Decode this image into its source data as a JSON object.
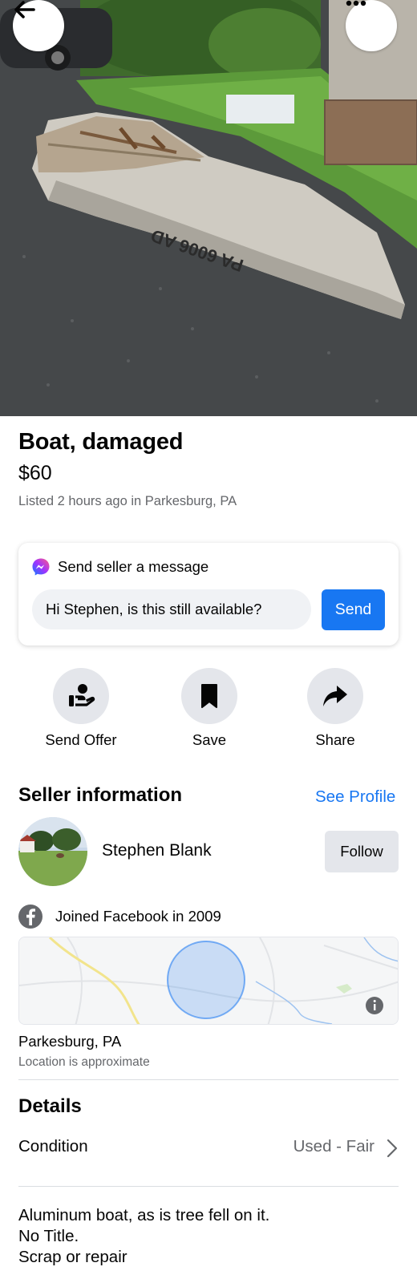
{
  "header": {
    "back_icon": "arrow-left-icon",
    "more_icon": "more-horizontal-icon",
    "photo_plate_text": "PA 6006 AD"
  },
  "listing": {
    "title": "Boat, damaged",
    "price": "$60",
    "listed": "Listed 2 hours ago in Parkesburg, PA"
  },
  "message": {
    "icon": "messenger-icon",
    "heading": "Send seller a message",
    "input_value": "Hi Stephen, is this still available?",
    "send_label": "Send"
  },
  "actions": [
    {
      "label": "Send Offer",
      "icon": "offer-hand-icon"
    },
    {
      "label": "Save",
      "icon": "bookmark-icon"
    },
    {
      "label": "Share",
      "icon": "share-arrow-icon"
    }
  ],
  "seller": {
    "section_title": "Seller information",
    "see_profile": "See Profile",
    "name": "Stephen Blank",
    "follow_label": "Follow",
    "joined": "Joined Facebook in 2009",
    "location": "Parkesburg, PA",
    "location_note": "Location is approximate"
  },
  "details": {
    "section_title": "Details",
    "condition_label": "Condition",
    "condition_value": "Used - Fair",
    "description_lines": [
      "Aluminum boat, as is tree fell on it.",
      "No Title.",
      "Scrap or repair"
    ]
  },
  "colors": {
    "accent": "#1877f2",
    "secondary_text": "#65676b",
    "button_gray": "#e4e6eb"
  }
}
